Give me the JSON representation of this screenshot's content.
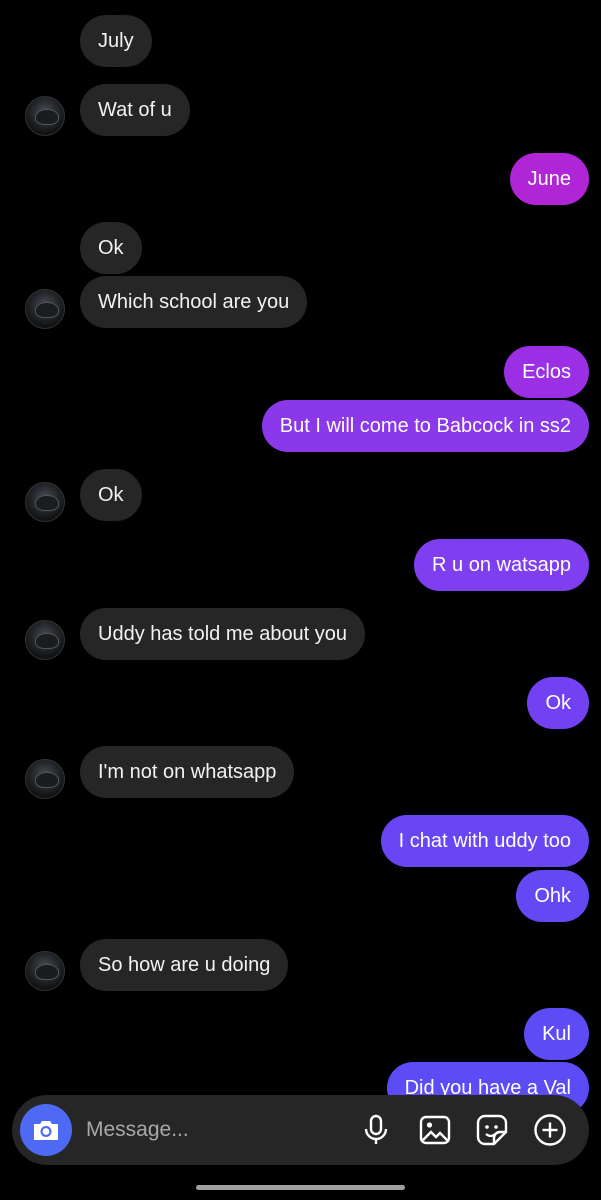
{
  "composer": {
    "placeholder": "Message...",
    "icons": [
      "camera-icon",
      "microphone-icon",
      "image-icon",
      "sticker-icon",
      "plus-icon"
    ],
    "send_color": "#4e6af5"
  },
  "colors": {
    "incoming_bubble": "#262626",
    "outgoing_top": "#b025d6",
    "outgoing_mid": "#7f3ff0",
    "outgoing_bottom": "#5b4cf5"
  },
  "messages": [
    {
      "from": "them",
      "text": "July"
    },
    {
      "from": "them",
      "text": "Wat of u"
    },
    {
      "from": "me",
      "text": "June"
    },
    {
      "from": "them",
      "text": "Ok"
    },
    {
      "from": "them",
      "text": "Which school are you"
    },
    {
      "from": "me",
      "text": "Eclos"
    },
    {
      "from": "me",
      "text": "But I will come to Babcock in ss2"
    },
    {
      "from": "them",
      "text": "Ok"
    },
    {
      "from": "me",
      "text": "R u on watsapp"
    },
    {
      "from": "them",
      "text": "Uddy has told me about you"
    },
    {
      "from": "me",
      "text": "Ok"
    },
    {
      "from": "them",
      "text": "I'm not on whatsapp"
    },
    {
      "from": "me",
      "text": "I chat with uddy too"
    },
    {
      "from": "me",
      "text": "Ohk"
    },
    {
      "from": "them",
      "text": "So how are u doing"
    },
    {
      "from": "me",
      "text": "Kul"
    },
    {
      "from": "me",
      "text": "Did you have a Val"
    }
  ]
}
